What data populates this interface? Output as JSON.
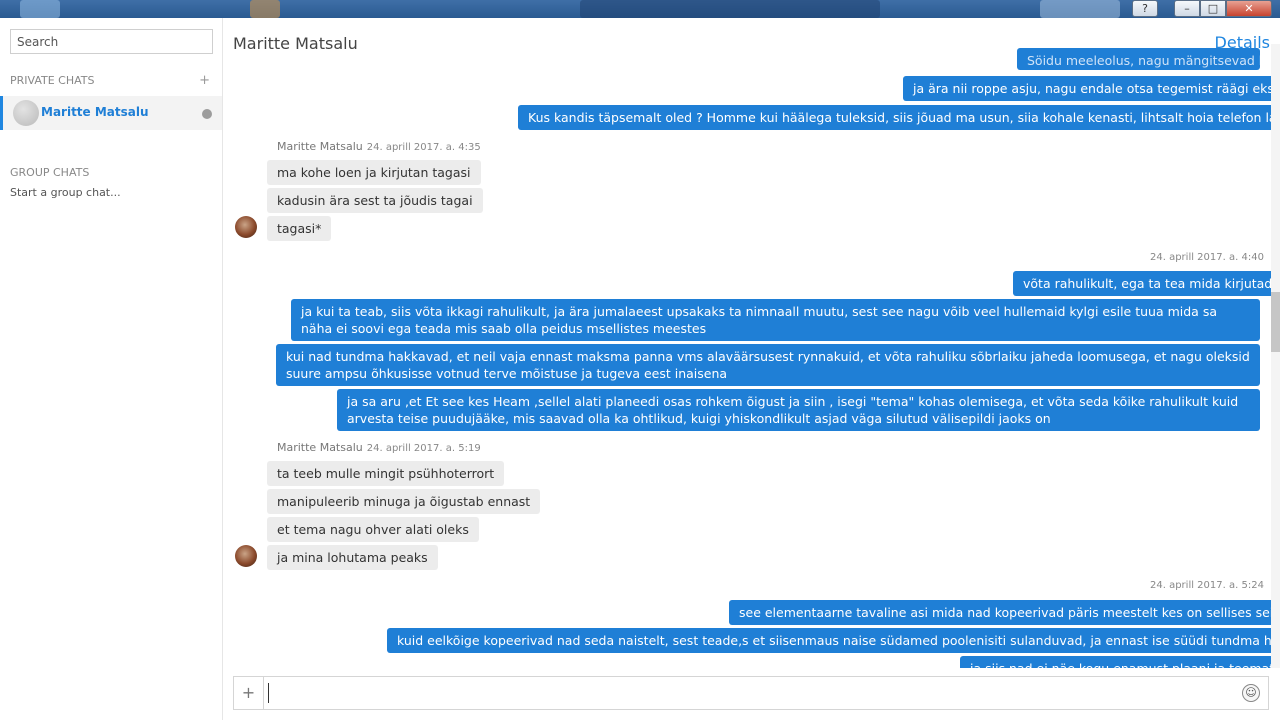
{
  "window": {
    "help_label": "?",
    "min_label": "–",
    "max_label": "□",
    "close_label": "✕"
  },
  "sidebar": {
    "search_placeholder": "Search",
    "private_title": "PRIVATE CHATS",
    "private_add": "+",
    "active_chat": "Maritte Matsalu",
    "group_title": "GROUP CHATS",
    "group_action": "Start a group chat..."
  },
  "header": {
    "contact": "Maritte Matsalu",
    "details": "Details"
  },
  "messages": {
    "m0": "Söidu meeleolus, nagu mängitsevad kogunisti, kuidas...",
    "m1": "ja ära nii roppe asju, nagu endale otsa tegemist räägi eks",
    "m2": "Kus kandis täpsemalt oled ? Homme kui häälega tuleksid, siis  jõuad ma usun, siia kohale kenasti, lihtsalt hoia telefon laetud,",
    "g1_who": "Maritte Matsalu",
    "g1_time": "24. aprill 2017. a. 4:35",
    "m3": "ma kohe loen ja kirjutan tagasi",
    "m4": "kadusin ära sest ta jõudis tagai",
    "m5": "tagasi*",
    "g2_time": "24. aprill 2017. a. 4:40",
    "m6": "võta rahulikult, ega ta tea mida kirjutad",
    "m7": "ja kui ta teab, siis võta ikkagi rahulikult, ja ära jumalaeest upsakaks ta nimnaall muutu, sest see nagu võib veel hullemaid kylgi esile tuua mida sa näha ei soovi  ega teada mis saab  olla peidus msellistes meestes",
    "m8": "kui nad tundma hakkavad, et neil vaja ennast maksma panna vms alaväärsusest rynnakuid, et võta rahuliku sõbrlaiku jaheda loomusega, et nagu oleksid suure ampsu õhkusisse votnud terve mõistuse ja tugeva eest inaisena",
    "m9": "ja sa aru ,et Et see kes Heam ,sellel alati planeedi osas rohkem õigust ja siin , isegi \"tema\" kohas olemisega, et võta seda kõike rahulikult kuid arvesta teise puudujääke, mis saavad olla ka ohtlikud, kuigi yhiskondlikult asjad väga silutud välisepildi jaoks on",
    "g3_who": "Maritte Matsalu",
    "g3_time": "24. aprill 2017. a. 5:19",
    "m10": "ta teeb mulle mingit psühhoterrort",
    "m11": "manipuleerib minuga ja õigustab ennast",
    "m12": "et tema nagu ohver alati oleks",
    "m13": "ja mina lohutama peaks",
    "g4_time": "24. aprill 2017. a. 5:24",
    "m14": "see elementaarne tavaline asi mida nad kopeerivad päris meestelt kes on sellises seisus",
    "m15": "kuid eelkõige kopeerivad nad seda naistelt, sest teade,s et siisenmaus naise südamed poolenisiti sulanduvad, ja ennast ise süüdi tundma hakkavad",
    "m16": "ja siis nad ei näe kogu enamust plaani ja teemat"
  },
  "composer": {
    "plus": "+",
    "emoji": "☺",
    "value": ""
  }
}
